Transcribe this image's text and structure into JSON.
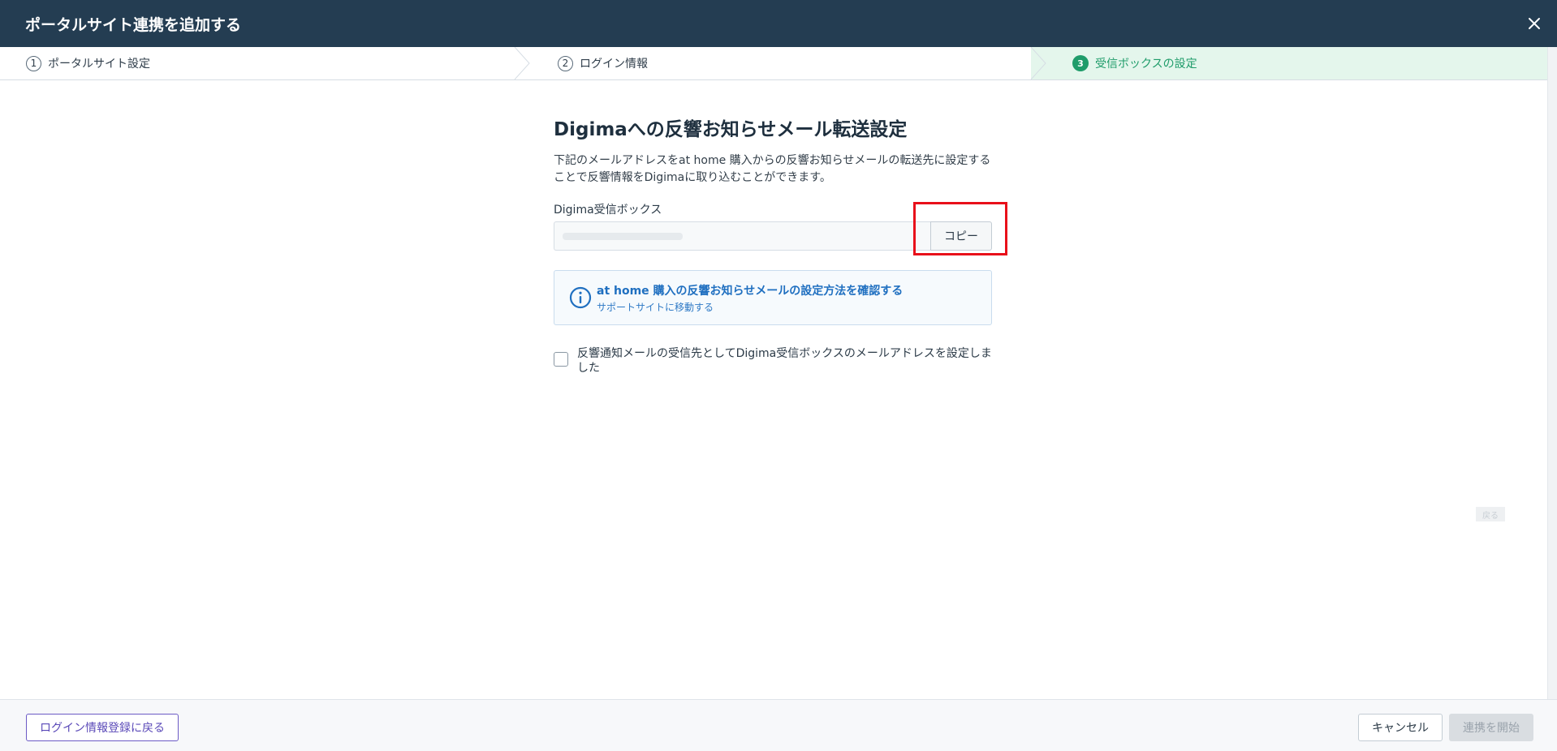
{
  "header": {
    "title": "ポータルサイト連携を追加する",
    "close_icon": "close-icon"
  },
  "steps": [
    {
      "num": "1",
      "label": "ポータルサイト設定"
    },
    {
      "num": "2",
      "label": "ログイン情報"
    },
    {
      "num": "3",
      "label": "受信ボックスの設定",
      "active": true
    }
  ],
  "main": {
    "title": "Digimaへの反響お知らせメール転送設定",
    "description": "下記のメールアドレスをat home 購入からの反響お知らせメールの転送先に設定することで反響情報をDigimaに取り込むことができます。",
    "inbox_label": "Digima受信ボックス",
    "copy_label": "コピー",
    "info": {
      "link": "at home 購入の反響お知らせメールの設定方法を確認する",
      "sub": "サポートサイトに移動する",
      "icon": "info-icon"
    },
    "checkbox_label": "反響通知メールの受信先としてDigima受信ボックスのメールアドレスを設定しました",
    "checked": false
  },
  "side_button": "戻る",
  "footer": {
    "back_label": "ログイン情報登録に戻る",
    "cancel_label": "キャンセル",
    "start_label": "連携を開始"
  },
  "colors": {
    "header": "#243d52",
    "accent_green": "#1f9c6a",
    "link_blue": "#1f6fc0",
    "highlight_red": "#e8101a"
  }
}
